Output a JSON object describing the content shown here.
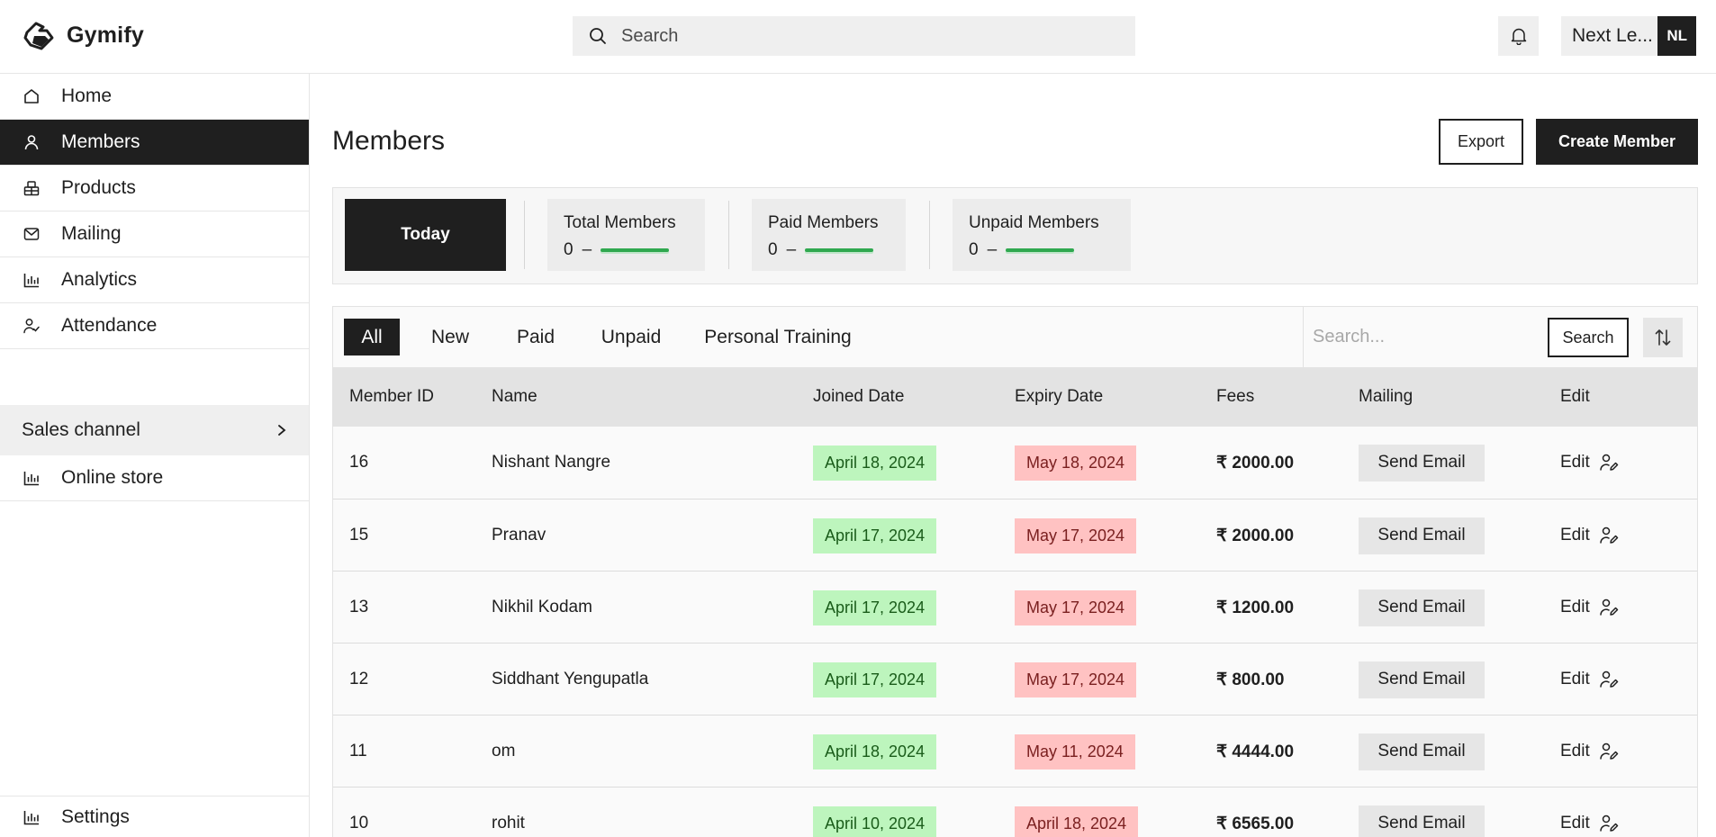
{
  "app": {
    "name": "Gymify"
  },
  "topbar": {
    "search_placeholder": "Search",
    "account_name": "Next Le...",
    "avatar_initials": "NL"
  },
  "sidebar": {
    "items": [
      {
        "label": "Home",
        "icon": "home-icon",
        "active": false
      },
      {
        "label": "Members",
        "icon": "user-icon",
        "active": true
      },
      {
        "label": "Products",
        "icon": "products-icon",
        "active": false
      },
      {
        "label": "Mailing",
        "icon": "mail-icon",
        "active": false
      },
      {
        "label": "Analytics",
        "icon": "bar-chart-icon",
        "active": false
      },
      {
        "label": "Attendance",
        "icon": "user-check-icon",
        "active": false
      }
    ],
    "sales_channel_label": "Sales channel",
    "online_store_label": "Online store",
    "settings_label": "Settings"
  },
  "main": {
    "title": "Members",
    "export_label": "Export",
    "create_label": "Create Member"
  },
  "stats": {
    "period_label": "Today",
    "cards": [
      {
        "label": "Total Members",
        "value": "0",
        "dash": "–"
      },
      {
        "label": "Paid Members",
        "value": "0",
        "dash": "–"
      },
      {
        "label": "Unpaid Members",
        "value": "0",
        "dash": "–"
      }
    ],
    "accent_color": "#2fa84f"
  },
  "filters": {
    "tabs": [
      "All",
      "New",
      "Paid",
      "Unpaid",
      "Personal Training"
    ],
    "active_tab": "All",
    "search_placeholder": "Search...",
    "search_button": "Search"
  },
  "table": {
    "columns": [
      "Member ID",
      "Name",
      "Joined Date",
      "Expiry Date",
      "Fees",
      "Mailing",
      "Edit"
    ],
    "send_label": "Send Email",
    "edit_label": "Edit",
    "rows": [
      {
        "id": "16",
        "name": "Nishant Nangre",
        "joined": "April 18, 2024",
        "expiry": "May 18, 2024",
        "fees": "₹ 2000.00"
      },
      {
        "id": "15",
        "name": "Pranav",
        "joined": "April 17, 2024",
        "expiry": "May 17, 2024",
        "fees": "₹ 2000.00"
      },
      {
        "id": "13",
        "name": "Nikhil Kodam",
        "joined": "April 17, 2024",
        "expiry": "May 17, 2024",
        "fees": "₹ 1200.00"
      },
      {
        "id": "12",
        "name": "Siddhant Yengupatla",
        "joined": "April 17, 2024",
        "expiry": "May 17, 2024",
        "fees": "₹ 800.00"
      },
      {
        "id": "11",
        "name": "om",
        "joined": "April 18, 2024",
        "expiry": "May 11, 2024",
        "fees": "₹ 4444.00"
      },
      {
        "id": "10",
        "name": "rohit",
        "joined": "April 10, 2024",
        "expiry": "April 18, 2024",
        "fees": "₹ 6565.00"
      }
    ]
  },
  "colors": {
    "primary": "#1f1f1f",
    "joined_bg": "#bdf5bd",
    "expiry_bg": "#ffc2c2",
    "surface": "#efefef"
  }
}
